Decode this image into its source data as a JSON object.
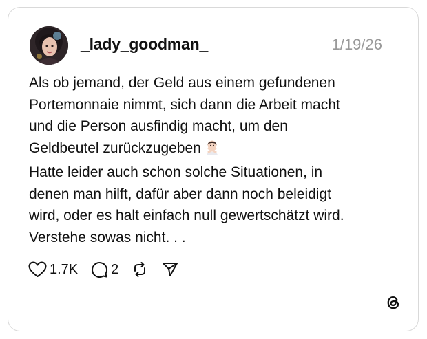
{
  "post": {
    "username": "_lady_goodman_",
    "date": "1/19/26",
    "lines": [
      "Als ob jemand, der Geld aus einem gefundenen",
      "Portemonnaie nimmt, sich dann die Arbeit macht",
      "und die Person ausfindig macht, um den",
      "Geldbeutel zurückzugeben",
      "Hatte leider auch schon solche Situationen, in",
      "denen man hilft, dafür aber dann noch beleidigt",
      "wird, oder es halt einfach null gewertschätzt wird.",
      "Verstehe sowas nicht. . ."
    ],
    "emoji_icon": "person-gesturing-no-icon"
  },
  "actions": {
    "likes": "1.7K",
    "comments": "2",
    "icons": [
      "heart-icon",
      "comment-icon",
      "repost-icon",
      "share-icon"
    ]
  },
  "brand": {
    "logo_icon": "threads-logo-icon"
  }
}
